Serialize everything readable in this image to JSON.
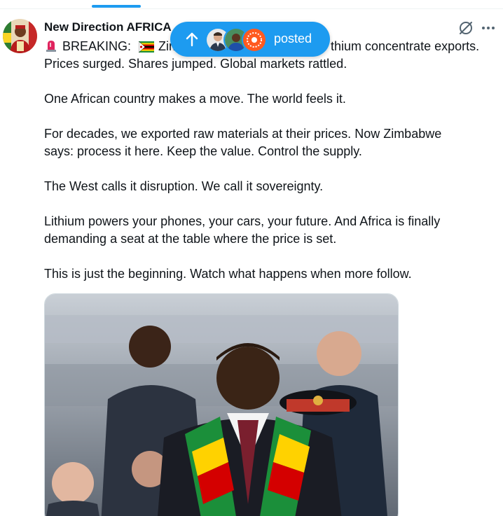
{
  "author": {
    "name": "New Direction AFRICA"
  },
  "pill": {
    "label": "posted"
  },
  "tweet": {
    "line1_prefix": "BREAKING:",
    "line1_a": "Zim",
    "line1_b": "thium concentrate exports.",
    "lines": [
      "Prices surged. Shares jumped. Global markets rattled.",
      "One African country makes a move. The world feels it.",
      "For decades, we exported raw materials at their prices. Now Zimbabwe",
      "says: process it here. Keep the value. Control the supply.",
      "The West calls it disruption. We call it sovereignty.",
      "Lithium powers your phones, your cars, your future. And Africa is finally",
      "demanding a seat at the table where the price is set.",
      "This is just the beginning. Watch what happens when more follow."
    ]
  },
  "icons": {
    "siren": "siren-icon",
    "flag": "zimbabwe-flag-icon",
    "grok": "grok-icon",
    "more": "more-icon",
    "arrow": "arrow-up-icon"
  },
  "colors": {
    "accent": "#1d9bf0",
    "text": "#0f1419",
    "border": "#cfd9de"
  }
}
